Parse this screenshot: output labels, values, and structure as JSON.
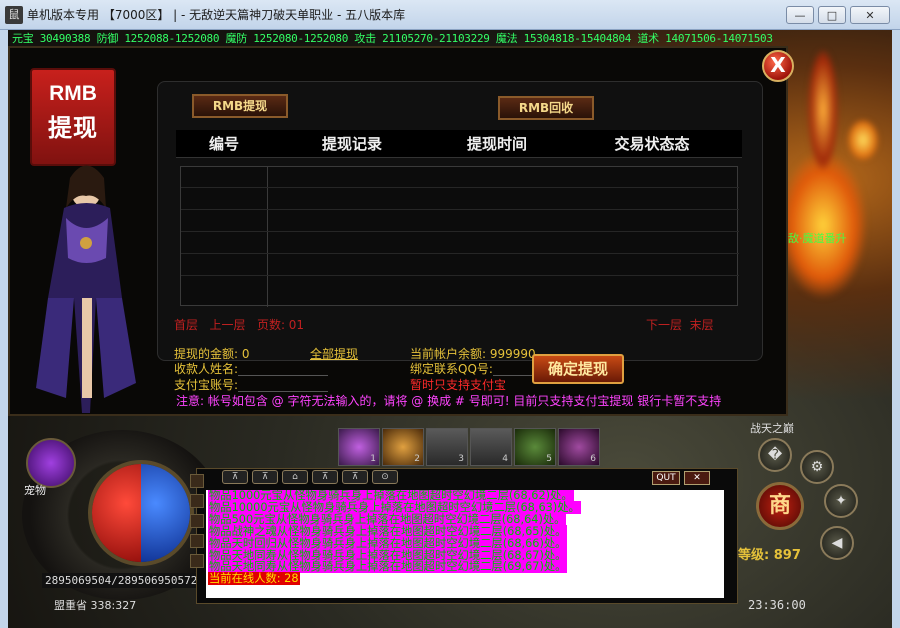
{
  "window": {
    "title": "单机版本专用 【7000区】 | - 无敌逆天篇神刀破天单职业 - 五八版本库",
    "icon": "鼠",
    "minimize": "—",
    "maximize": "□",
    "close": "✕"
  },
  "stats_bar": "元宝 30490388 防御 1252088-1252080 魔防 1252080-1252080 攻击 21105270-21103229 魔法 15304818-15404804 道术 14071506-14071503",
  "scene": {
    "right_label": "敌·魔道番升"
  },
  "panel": {
    "badge_line1": "RMB",
    "badge_line2": "提现",
    "tab_withdraw": "RMB提现",
    "tab_recycle": "RMB回收",
    "columns": [
      "编号",
      "提现记录",
      "提现时间",
      "交易状态态"
    ],
    "pager": {
      "first": "首层",
      "prev": "上一层",
      "page_label": "页数: 01",
      "next": "下一层",
      "last": "末层"
    },
    "withdraw_amount_label": "提现的金额: 0",
    "withdraw_all": "全部提现",
    "balance_label": "当前帐户余额: 999990",
    "payee_name_label": "收款人姓名:",
    "bind_qq_label": "绑定联系QQ号:",
    "alipay_label": "支付宝账号:",
    "alipay_only": "暂时只支持支付宝",
    "confirm_button": "确定提现",
    "notice": "注意: 帐号如包含 @ 字符无法输入的，请将 @ 换成 # 号即可! 目前只支持支付宝提现 银行卡暂不支持",
    "close_icon": "X"
  },
  "hud": {
    "pet_label": "宠物",
    "hp_mp_text": "2895069504/2895069505724",
    "location": "盟重省  338:327",
    "skill_slots": [
      "1",
      "2",
      "3",
      "4",
      "5",
      "6"
    ],
    "chat_tools": [
      "⊼",
      "⊼",
      "⌂",
      "⊼",
      "⊼",
      "⊙"
    ],
    "chat_quit": "QUT",
    "chat_close": "✕",
    "chat_lines": [
      "物品1000元宝从怪物身骑兵身上掉落在地图超时空幻境二层(68,62)处。",
      "物品10000元宝从怪物身骑兵身上掉落在地图超时空幻境二层(68,63)处。",
      "物品500元宝从怪物身骑兵身上掉落在地图超时空幻境二层(68,64)处。",
      "物品战神之魂从怪物身骑兵身上掉落在地图超时空幻境二层(68,65)处。",
      "物品天时回归从怪物身骑兵身上掉落在地图超时空幻境二层(68,66)处。",
      "物品天地同寿从怪物身骑兵身上掉落在地图超时空幻境二层(68,67)处。",
      "物品天地同寿从怪物身骑兵身上掉落在地图超时空幻境二层(69,67)处。"
    ],
    "online_count": "当前在线人数: 28",
    "level_label": "等级: 897",
    "clock": "23:36:00",
    "shop": "商",
    "zhan_label": "战天之巅",
    "round_btn_1": "�",
    "round_btn_2": "⚙",
    "round_btn_3": "✦",
    "round_btn_4": "◀"
  },
  "colors": {
    "accent_gold": "#e6c23a",
    "alert_red": "#ff2a2a",
    "notice_magenta": "#ff44ff",
    "stats_green": "#33ff66"
  }
}
